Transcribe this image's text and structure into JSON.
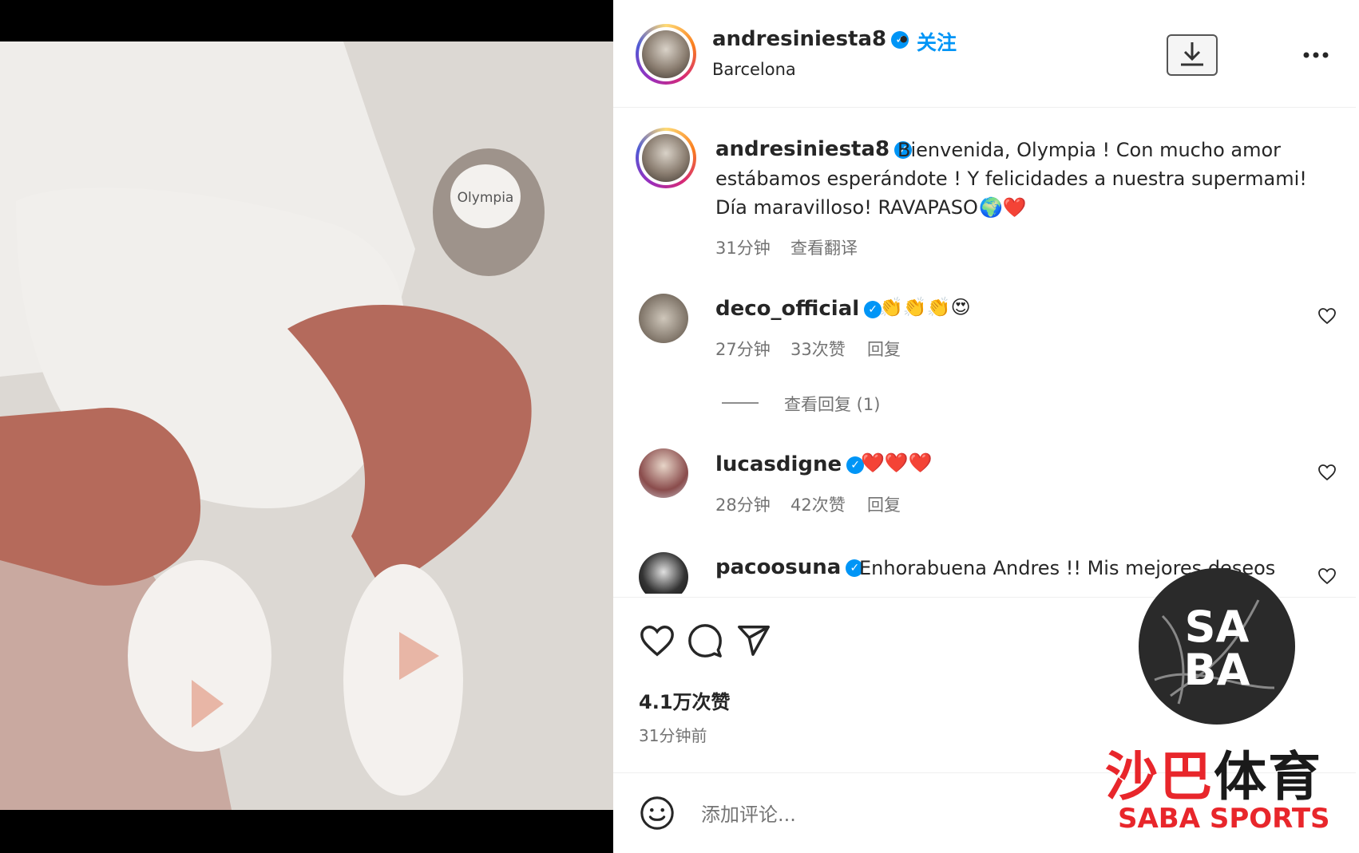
{
  "post": {
    "username": "andresiniesta8",
    "separator": "•",
    "follow_label": "关注",
    "location": "Barcelona",
    "pacifier_text": "Olympia"
  },
  "caption": {
    "username": "andresiniesta8",
    "line1": "Bienvenida, Olympia ! Con mucho amor",
    "line2": "estábamos esperándote ! Y felicidades a nuestra supermami!",
    "line3": "Día maravilloso! RAVAPASO",
    "emoji": "🌍❤️",
    "time": "31分钟",
    "translate": "查看翻译"
  },
  "comments": [
    {
      "username": "deco_official",
      "text": "👏👏👏😍",
      "time": "27分钟",
      "likes": "33次赞",
      "reply": "回复",
      "view_replies": "查看回复 (1)"
    },
    {
      "username": "lucasdigne",
      "text": "❤️❤️❤️",
      "time": "28分钟",
      "likes": "42次赞",
      "reply": "回复"
    },
    {
      "username": "pacoosuna",
      "text": "Enhorabuena Andres !! Mis mejores deseos"
    }
  ],
  "stats": {
    "likes": "4.1万次赞",
    "posted": "31分钟前"
  },
  "comment_box": {
    "placeholder": "添加评论..."
  },
  "watermark": {
    "logo_line1": "SA",
    "logo_line2": "BA",
    "cn_part1": "沙巴",
    "cn_part2": "体育",
    "en": "SABA SPORTS"
  },
  "colors": {
    "verified": "#0095f6",
    "follow": "#0095f6",
    "brand_red": "#e8262b"
  }
}
